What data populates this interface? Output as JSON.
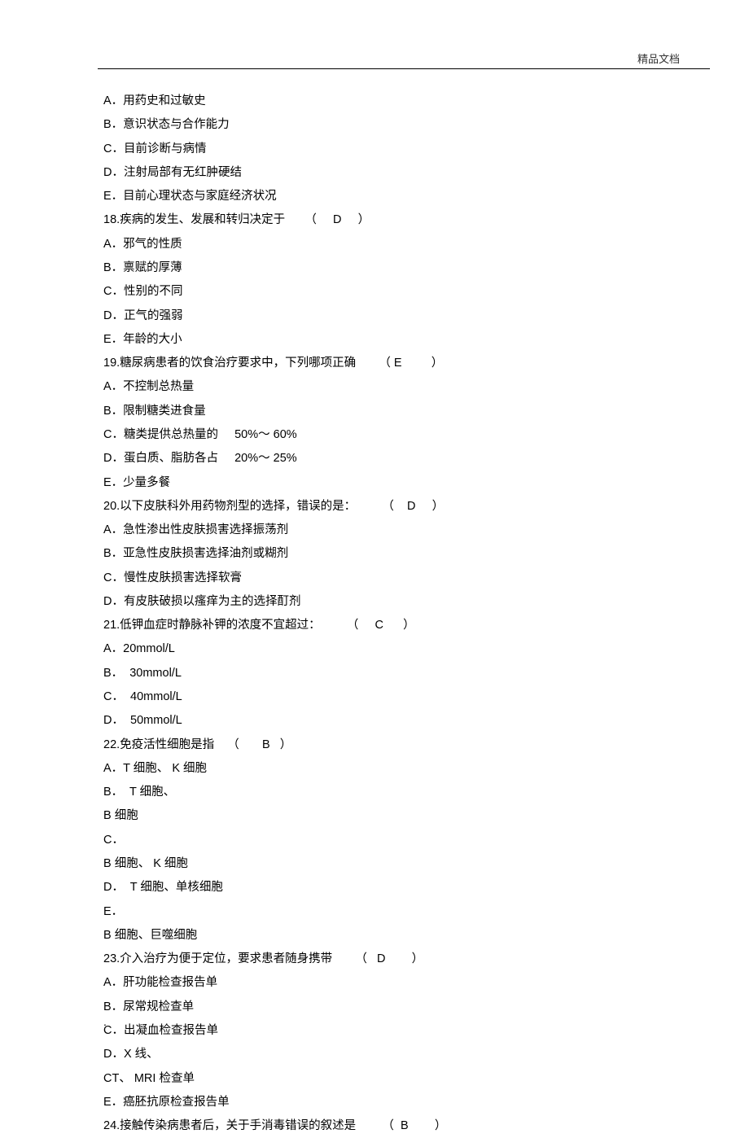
{
  "header": {
    "label": "精品文档"
  },
  "lines": [
    "A．用药史和过敏史",
    "B．意识状态与合作能力",
    "C．目前诊断与病情",
    "D．注射局部有无红肿硬结",
    "E．目前心理状态与家庭经济状况",
    "18.疾病的发生、发展和转归决定于      （     D     ）",
    "A．邪气的性质",
    "B．禀赋的厚薄",
    "C．性别的不同",
    "D．正气的强弱",
    "E．年龄的大小",
    "19.糖尿病患者的饮食治疗要求中，下列哪项正确       （ E         ）",
    "A．不控制总热量",
    "B．限制糖类进食量",
    "C．糖类提供总热量的     50%～ 60%",
    "D．蛋白质、脂肪各占     20%～ 25%",
    "E．少量多餐",
    "20.以下皮肤科外用药物剂型的选择，错误的是：        （    D     ）",
    "A．急性渗出性皮肤损害选择振荡剂",
    "B．亚急性皮肤损害选择油剂或糊剂",
    "C．慢性皮肤损害选择软膏",
    "D．有皮肤破损以瘙痒为主的选择酊剂",
    "21.低钾血症时静脉补钾的浓度不宜超过：        （     C      ）",
    "A．20mmol/L",
    "B．  30mmol/L",
    "C．  40mmol/L",
    "D．  50mmol/L",
    "22.免疫活性细胞是指    （       B   ）",
    "A．T 细胞、 K 细胞",
    "B．  T 细胞、",
    "B 细胞",
    "C．",
    "B 细胞、 K 细胞",
    "D．  T 细胞、单核细胞",
    "E．",
    "B 细胞、巨噬细胞",
    "23.介入治疗为便于定位，要求患者随身携带       （   D        ）",
    "A．肝功能检查报告单",
    "B．尿常规检查单",
    "C．出凝血检查报告单",
    "D．X 线、",
    "CT、 MRI 检查单",
    "E．癌胚抗原检查报告单",
    "24.接触传染病患者后，关于手消毒错误的叙述是        （  B        ）"
  ],
  "footer": {
    "dot": "."
  }
}
